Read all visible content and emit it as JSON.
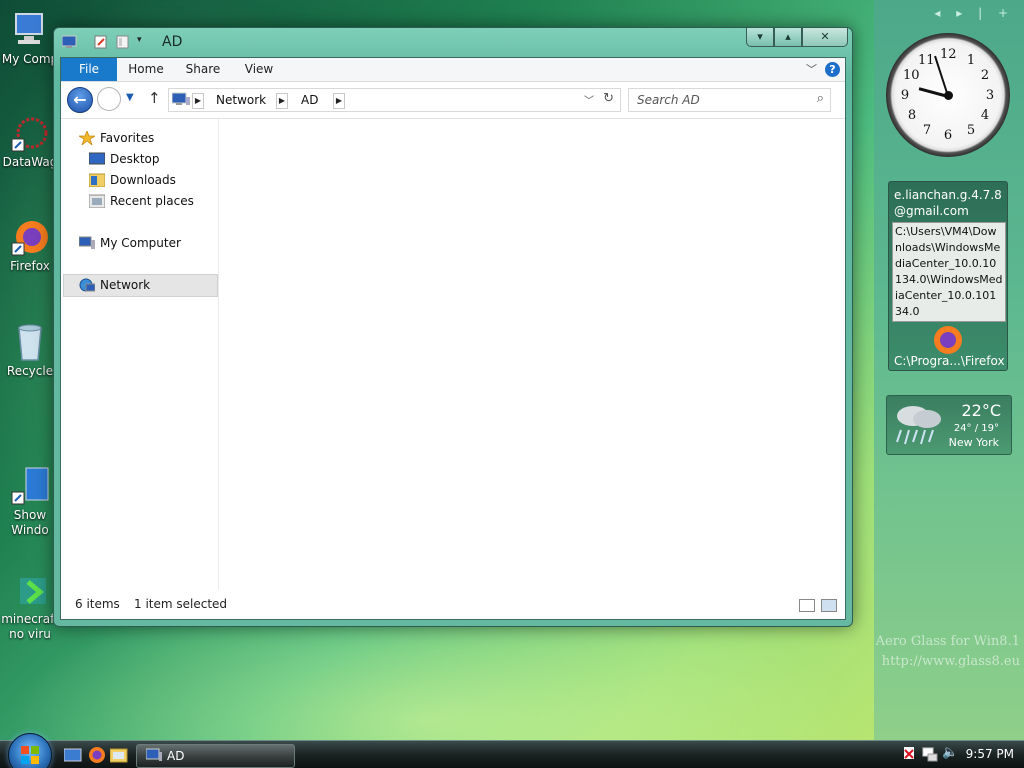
{
  "desktop": {
    "icons": [
      {
        "label": "My Comp",
        "icon": "computer-icon"
      },
      {
        "label": "DataWag",
        "icon": "datawag-icon"
      },
      {
        "label": "Firefox",
        "icon": "firefox-icon"
      },
      {
        "label": "Recycle",
        "icon": "recycle-bin-icon"
      },
      {
        "label": "Show\nWindo",
        "icon": "show-desktop-icon"
      },
      {
        "label": "minecraft\nno viru",
        "icon": "minecraft-icon"
      }
    ]
  },
  "window": {
    "title": "AD",
    "buttons": {
      "minimize": "▾",
      "maximize": "▴",
      "close": "✕"
    },
    "ribbon": {
      "tabs": [
        "File",
        "Home",
        "Share",
        "View"
      ],
      "help": "?"
    },
    "navbar": {
      "breadcrumbs": [
        "Network",
        "AD"
      ],
      "search_placeholder": "Search AD"
    },
    "navpane": {
      "favorites_label": "Favorites",
      "favorites": [
        "Desktop",
        "Downloads",
        "Recent places"
      ],
      "my_computer": "My Computer",
      "network": "Network"
    },
    "status": {
      "items": "6 items",
      "selected": "1 item selected"
    }
  },
  "gadgets": {
    "clock": {
      "numbers": [
        "12",
        "1",
        "2",
        "3",
        "4",
        "5",
        "6",
        "7",
        "8",
        "9",
        "10",
        "11"
      ],
      "time_display": "9:57"
    },
    "notes": {
      "email": "e.lianchan.g.4.7.8\n@gmail.com",
      "path": "C:\\Users\\VM4\\Downloads\\WindowsMediaCenter_10.0.10134.0\\WindowsMediaCenter_10.0.10134.0",
      "shortcut": "C:\\Progra...\\Firefox"
    },
    "weather": {
      "temp": "22°C",
      "highlow": "24° / 19°",
      "city": "New York"
    }
  },
  "watermark": {
    "line1": "Aero Glass for Win8.1",
    "line2": "http://www.glass8.eu"
  },
  "taskbar": {
    "active_window": "AD",
    "time": "9:57 PM"
  },
  "colors": {
    "accent": "#1979ca",
    "window_frame": "#64b9a0"
  }
}
